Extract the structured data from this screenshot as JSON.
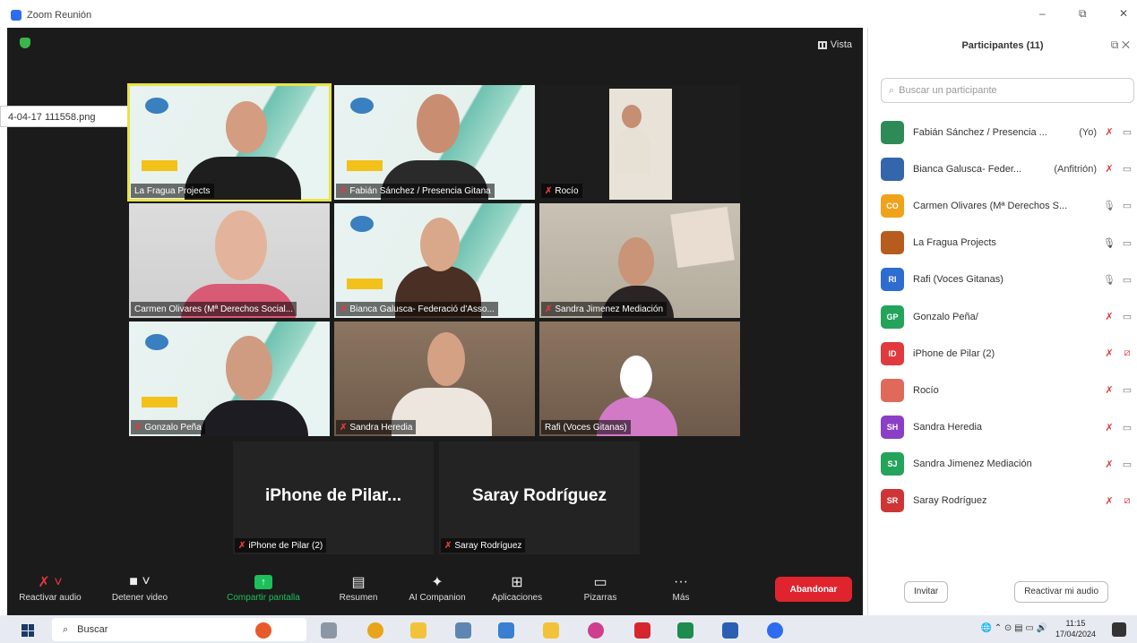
{
  "window": {
    "title": "Zoom Reunión",
    "minimize": "–",
    "maximize": "⧉",
    "close": "✕"
  },
  "meeting": {
    "view_label": "Vista",
    "file_label": "4-04-17 111558.png",
    "tiles": [
      {
        "name": "La Fragua Projects",
        "muted": false,
        "active": true
      },
      {
        "name": "Fabián Sánchez / Presencia Gitana",
        "muted": true,
        "active": false
      },
      {
        "name": "Rocío",
        "muted": true,
        "active": false
      },
      {
        "name": "Carmen Olivares (Mª Derechos Social...",
        "muted": false,
        "active": false
      },
      {
        "name": "Bianca Galusca- Federació d'Asso...",
        "muted": true,
        "active": false
      },
      {
        "name": "Sandra Jimenez Mediación",
        "muted": true,
        "active": false
      },
      {
        "name": "Gonzalo Peña",
        "muted": true,
        "active": false
      },
      {
        "name": "Sandra Heredia",
        "muted": true,
        "active": false
      },
      {
        "name": "Rafi (Voces Gitanas)",
        "muted": false,
        "active": false
      }
    ],
    "big_tiles": [
      {
        "display": "iPhone de Pilar...",
        "name": "iPhone de Pilar (2)"
      },
      {
        "display": "Saray Rodríguez",
        "name": "Saray Rodríguez"
      }
    ]
  },
  "toolbar": {
    "items": [
      {
        "label": "Reactivar audio",
        "icon": "mic-muted-icon",
        "glyph": "🎤"
      },
      {
        "label": "Detener video",
        "icon": "video-icon",
        "glyph": "■"
      },
      {
        "label": "Compartir pantalla",
        "icon": "share-screen-icon",
        "glyph": "↑"
      },
      {
        "label": "Resumen",
        "icon": "summary-icon",
        "glyph": "▤"
      },
      {
        "label": "AI Companion",
        "icon": "ai-companion-icon",
        "glyph": "✦"
      },
      {
        "label": "Aplicaciones",
        "icon": "apps-icon",
        "glyph": "⊞"
      },
      {
        "label": "Pizarras",
        "icon": "whiteboard-icon",
        "glyph": "▭"
      },
      {
        "label": "Más",
        "icon": "more-icon",
        "glyph": "···"
      }
    ],
    "leave_label": "Abandonar"
  },
  "panel": {
    "title": "Participantes (11)",
    "search_placeholder": "Buscar un participante",
    "participants": [
      {
        "name": "Fabián Sánchez / Presencia ...",
        "role": "(Yo)",
        "initials": "",
        "color": "#2e8b57",
        "mic": "muted",
        "cam": "on"
      },
      {
        "name": "Bianca Galusca- Feder...",
        "role": "(Anfitrión)",
        "initials": "",
        "color": "#3366aa",
        "mic": "muted",
        "cam": "on"
      },
      {
        "name": "Carmen Olivares (Mª Derechos S...",
        "role": "",
        "initials": "CO",
        "color": "#f0a21a",
        "mic": "on",
        "cam": "on"
      },
      {
        "name": "La Fragua Projects",
        "role": "",
        "initials": "",
        "color": "#b65c1e",
        "mic": "on",
        "cam": "on"
      },
      {
        "name": "Rafi (Voces Gitanas)",
        "role": "",
        "initials": "RI",
        "color": "#2d6cd1",
        "mic": "on",
        "cam": "on"
      },
      {
        "name": "Gonzalo Peña/",
        "role": "",
        "initials": "GP",
        "color": "#24a35a",
        "mic": "muted",
        "cam": "on"
      },
      {
        "name": "iPhone de Pilar (2)",
        "role": "",
        "initials": "ID",
        "color": "#e0393e",
        "mic": "muted",
        "cam": "off"
      },
      {
        "name": "Rocío",
        "role": "",
        "initials": "",
        "color": "#e06a5a",
        "mic": "muted",
        "cam": "on"
      },
      {
        "name": "Sandra Heredia",
        "role": "",
        "initials": "SH",
        "color": "#8a3fc6",
        "mic": "muted",
        "cam": "on"
      },
      {
        "name": "Sandra Jimenez Mediación",
        "role": "",
        "initials": "SJ",
        "color": "#24a35a",
        "mic": "muted",
        "cam": "on"
      },
      {
        "name": "Saray Rodríguez",
        "role": "",
        "initials": "SR",
        "color": "#d03535",
        "mic": "muted",
        "cam": "off"
      }
    ],
    "invite_label": "Invitar",
    "unmute_all_label": "Reactivar mi audio"
  },
  "taskbar": {
    "search_label": "Buscar",
    "time": "11:15",
    "date": "17/04/2024"
  }
}
